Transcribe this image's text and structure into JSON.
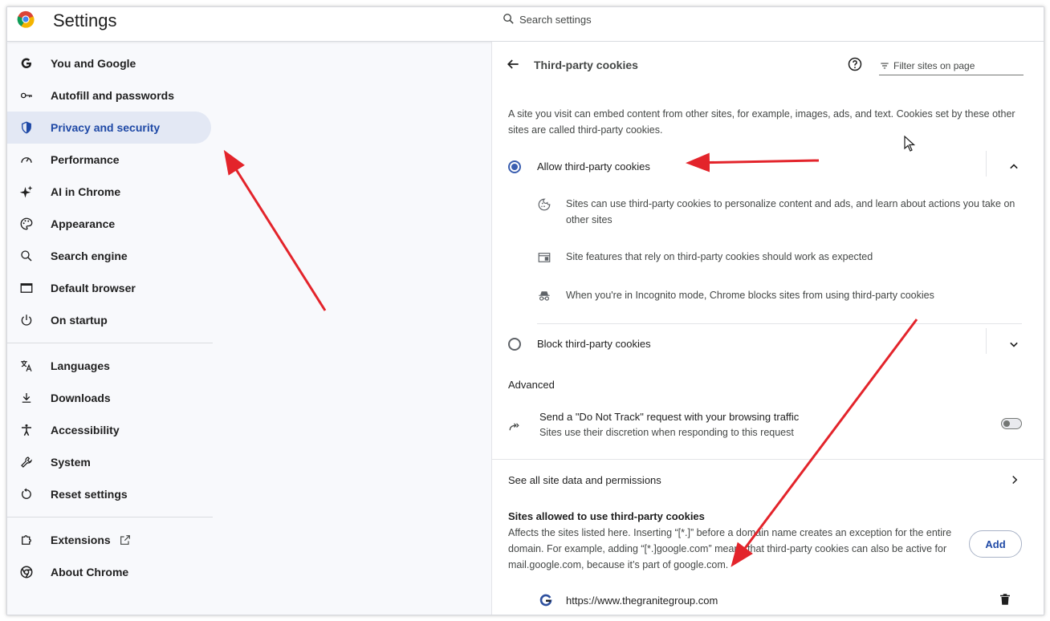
{
  "window": {
    "title": "Settings"
  },
  "search": {
    "placeholder": "Search settings"
  },
  "sidebar": {
    "items": [
      {
        "label": "You and Google",
        "icon": "google-g-icon"
      },
      {
        "label": "Autofill and passwords",
        "icon": "key-icon"
      },
      {
        "label": "Privacy and security",
        "icon": "shield-icon",
        "active": true
      },
      {
        "label": "Performance",
        "icon": "speedometer-icon"
      },
      {
        "label": "AI in Chrome",
        "icon": "sparkle-icon"
      },
      {
        "label": "Appearance",
        "icon": "palette-icon"
      },
      {
        "label": "Search engine",
        "icon": "search-icon"
      },
      {
        "label": "Default browser",
        "icon": "browser-window-icon"
      },
      {
        "label": "On startup",
        "icon": "power-icon"
      }
    ],
    "items2": [
      {
        "label": "Languages",
        "icon": "translate-icon"
      },
      {
        "label": "Downloads",
        "icon": "download-icon"
      },
      {
        "label": "Accessibility",
        "icon": "accessibility-icon"
      },
      {
        "label": "System",
        "icon": "wrench-icon"
      },
      {
        "label": "Reset settings",
        "icon": "reset-icon"
      }
    ],
    "items3": [
      {
        "label": "Extensions",
        "icon": "puzzle-icon"
      },
      {
        "label": "About Chrome",
        "icon": "chrome-icon"
      }
    ]
  },
  "page": {
    "title": "Third-party cookies",
    "filter_placeholder": "Filter sites on page",
    "description": "A site you visit can embed content from other sites, for example, images, ads, and text. Cookies set by these other sites are called third-party cookies.",
    "options": {
      "allow": {
        "label": "Allow third-party cookies",
        "checked": true,
        "bullets": [
          {
            "icon": "cookie-icon",
            "text": "Sites can use third-party cookies to personalize content and ads, and learn about actions you take on other sites"
          },
          {
            "icon": "web-features-icon",
            "text": "Site features that rely on third-party cookies should work as expected"
          },
          {
            "icon": "incognito-icon",
            "text": "When you're in Incognito mode, Chrome blocks sites from using third-party cookies"
          }
        ]
      },
      "block": {
        "label": "Block third-party cookies",
        "checked": false
      }
    },
    "advanced": {
      "heading": "Advanced",
      "dnt_title": "Send a \"Do Not Track\" request with your browsing traffic",
      "dnt_subtitle": "Sites use their discretion when responding to this request",
      "dnt_enabled": false
    },
    "see_all_label": "See all site data and permissions",
    "allowed": {
      "title": "Sites allowed to use third-party cookies",
      "description": "Affects the sites listed here. Inserting “[*.]” before a domain name creates an exception for the entire domain. For example, adding “[*.]google.com” means that third-party cookies can also be active for mail.google.com, because it’s part of google.com.",
      "add_label": "Add",
      "sites": [
        {
          "url": "https://www.thegranitegroup.com"
        }
      ]
    }
  },
  "colors": {
    "accent": "#1f49a6",
    "active_bg": "#e3e8f4",
    "annotation": "#e3242b"
  }
}
